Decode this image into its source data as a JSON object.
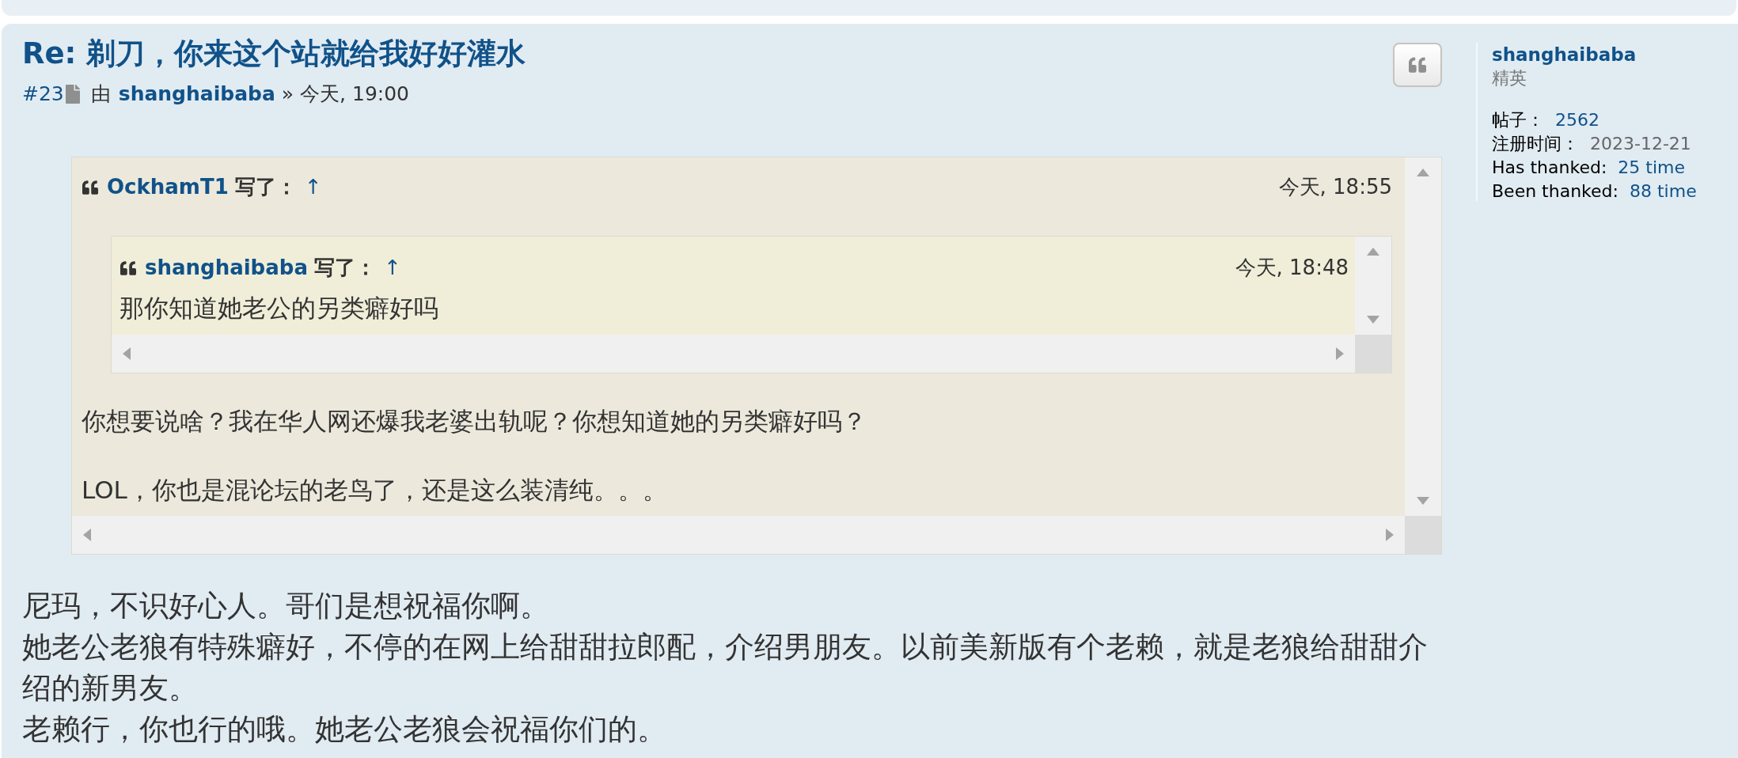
{
  "post": {
    "title": "Re: 剃刀，你来这个站就给我好好灌水",
    "number": "#23",
    "by": "由",
    "author": "shanghaibaba",
    "separator": "»",
    "time": "今天, 19:00",
    "quote": {
      "author": "OckhamT1",
      "wrote": "写了：",
      "arrow": "↑",
      "time": "今天, 18:55",
      "quote": {
        "author": "shanghaibaba",
        "wrote": "写了：",
        "arrow": "↑",
        "time": "今天, 18:48",
        "paragraphs": [
          "那你知道她老公的另类癖好吗"
        ]
      },
      "paragraphs": [
        "你想要说啥？我在华人网还爆我老婆出轨呢？你想知道她的另类癖好吗？",
        "LOL，你也是混论坛的老鸟了，还是这么装清纯。。。"
      ]
    },
    "body": [
      "尼玛，不识好心人。哥们是想祝福你啊。",
      "她老公老狼有特殊癖好，不停的在网上给甜甜拉郎配，介绍男朋友。以前美新版有个老赖，就是老狼给甜甜介绍的新男友。",
      "老赖行，你也行的哦。她老公老狼会祝福你们的。"
    ]
  },
  "profile": {
    "username": "shanghaibaba",
    "rank": "精英",
    "stats": [
      {
        "label": "帖子：",
        "value": "2562",
        "kind": "link"
      },
      {
        "label": "注册时间：",
        "value": "2023-12-21",
        "kind": "plain"
      },
      {
        "label": "Has thanked:",
        "value": "25 time",
        "kind": "link"
      },
      {
        "label": "Been thanked:",
        "value": "88 time",
        "kind": "link"
      }
    ]
  }
}
